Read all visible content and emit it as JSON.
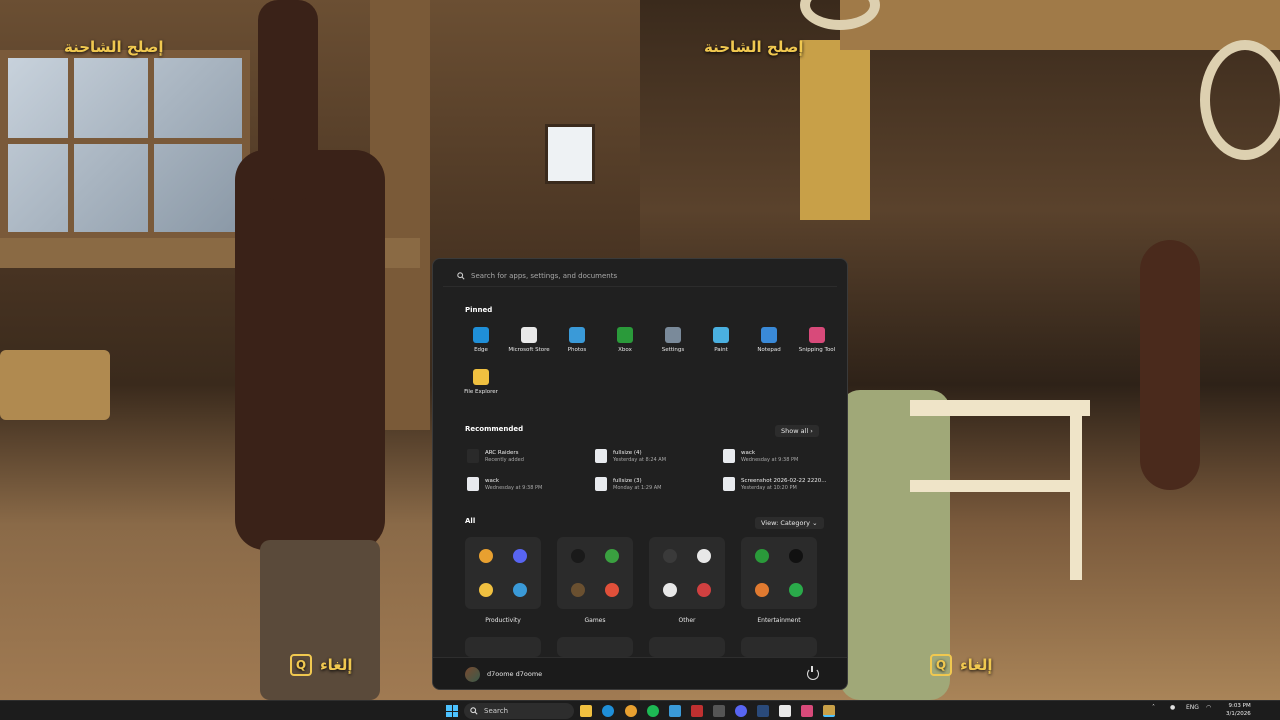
{
  "game": {
    "objective_left": "إصلح الشاحنة",
    "objective_right": "إصلح الشاحنة",
    "prompt_key": "Q",
    "prompt_left": "إلغاء",
    "prompt_right": "إلغاء"
  },
  "start_menu": {
    "search_placeholder": "Search for apps, settings, and documents",
    "pinned_title": "Pinned",
    "pinned": [
      {
        "label": "Edge",
        "icon": "edge-icon",
        "color": "#1f8fd8"
      },
      {
        "label": "Microsoft Store",
        "icon": "store-icon",
        "color": "#e8e8e8"
      },
      {
        "label": "Photos",
        "icon": "photos-icon",
        "color": "#3a9ad8"
      },
      {
        "label": "Xbox",
        "icon": "xbox-icon",
        "color": "#2a9a3a"
      },
      {
        "label": "Settings",
        "icon": "settings-icon",
        "color": "#7a8a9a"
      },
      {
        "label": "Paint",
        "icon": "paint-icon",
        "color": "#4ab0e0"
      },
      {
        "label": "Notepad",
        "icon": "notepad-icon",
        "color": "#3a8ad8"
      },
      {
        "label": "Snipping Tool",
        "icon": "snipping-tool-icon",
        "color": "#d84a7a"
      },
      {
        "label": "File Explorer",
        "icon": "file-explorer-icon",
        "color": "#f0c040"
      }
    ],
    "recommended_title": "Recommended",
    "show_all": "Show all",
    "recommended": [
      {
        "name": "ARC Raiders",
        "sub": "Recently added",
        "icon": "arc-raiders-icon"
      },
      {
        "name": "fullsize (4)",
        "sub": "Yesterday at 8:24 AM",
        "icon": "file-icon"
      },
      {
        "name": "wack",
        "sub": "Wednesday at 9:38 PM",
        "icon": "file-icon"
      },
      {
        "name": "wack",
        "sub": "Wednesday at 9:38 PM",
        "icon": "obs-icon"
      },
      {
        "name": "fullsize (3)",
        "sub": "Monday at 1:29 AM",
        "icon": "file-icon"
      },
      {
        "name": "Screenshot 2026-02-22 2220...",
        "sub": "Yesterday at 10:20 PM",
        "icon": "image-file-icon"
      }
    ],
    "all_title": "All",
    "view_category": "View: Category",
    "categories": [
      {
        "label": "Productivity",
        "icons": [
          {
            "icon": "chrome-icon",
            "color": "#e8a030"
          },
          {
            "icon": "discord-icon",
            "color": "#5865f2"
          },
          {
            "icon": "folder-icon",
            "color": "#f0c040"
          },
          {
            "icon": "ms-store-icon",
            "color": "#3a9ad8"
          }
        ]
      },
      {
        "label": "Games",
        "icons": [
          {
            "icon": "arc-raiders-icon",
            "color": "#1a1a1a"
          },
          {
            "icon": "minecraft-icon",
            "color": "#3aa040"
          },
          {
            "icon": "minecraft-block-icon",
            "color": "#6a5030"
          },
          {
            "icon": "game-bundle-icon",
            "color": "#e0503a"
          }
        ]
      },
      {
        "label": "Other",
        "icons": [
          {
            "icon": "obs-icon",
            "color": "#3a3a3a"
          },
          {
            "icon": "controller-icon",
            "color": "#e8e8e8"
          },
          {
            "icon": "steam-icon",
            "color": "#e8e8e8"
          },
          {
            "icon": "adobe-icon",
            "color": "#d04040"
          }
        ]
      },
      {
        "label": "Entertainment",
        "icons": [
          {
            "icon": "xbox-icon",
            "color": "#2a9a3a"
          },
          {
            "icon": "epic-games-icon",
            "color": "#111111"
          },
          {
            "icon": "media-player-icon",
            "color": "#e07a30"
          },
          {
            "icon": "game-pass-icon",
            "color": "#2aaa4a"
          }
        ]
      }
    ],
    "user_name": "d7oome d7oome"
  },
  "taskbar": {
    "search_label": "Search",
    "tray_lang": "ENG",
    "time": "9:03 PM",
    "date": "3/1/2026"
  }
}
